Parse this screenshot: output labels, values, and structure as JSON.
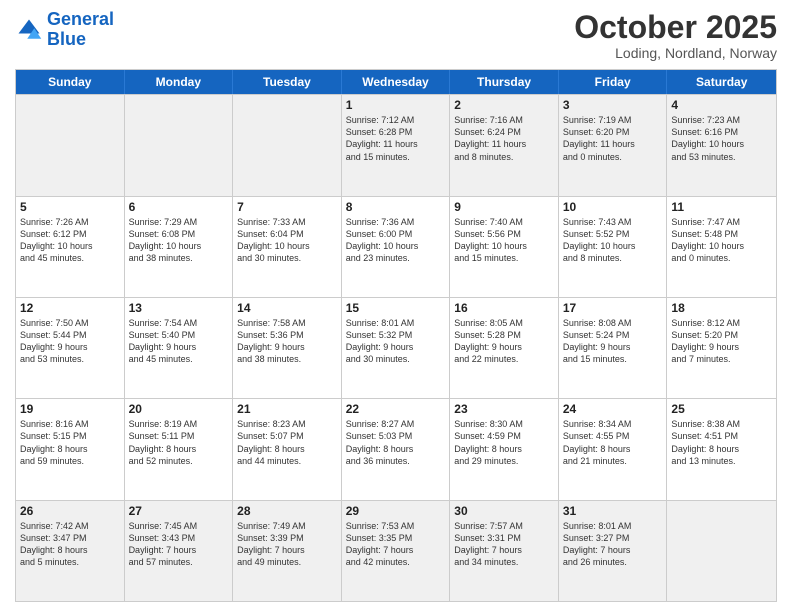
{
  "header": {
    "logo_general": "General",
    "logo_blue": "Blue",
    "month": "October 2025",
    "location": "Loding, Nordland, Norway"
  },
  "days_of_week": [
    "Sunday",
    "Monday",
    "Tuesday",
    "Wednesday",
    "Thursday",
    "Friday",
    "Saturday"
  ],
  "weeks": [
    [
      {
        "day": "",
        "info": [],
        "empty": true
      },
      {
        "day": "",
        "info": [],
        "empty": true
      },
      {
        "day": "",
        "info": [],
        "empty": true
      },
      {
        "day": "1",
        "info": [
          "Sunrise: 7:12 AM",
          "Sunset: 6:28 PM",
          "Daylight: 11 hours",
          "and 15 minutes."
        ],
        "empty": false
      },
      {
        "day": "2",
        "info": [
          "Sunrise: 7:16 AM",
          "Sunset: 6:24 PM",
          "Daylight: 11 hours",
          "and 8 minutes."
        ],
        "empty": false
      },
      {
        "day": "3",
        "info": [
          "Sunrise: 7:19 AM",
          "Sunset: 6:20 PM",
          "Daylight: 11 hours",
          "and 0 minutes."
        ],
        "empty": false
      },
      {
        "day": "4",
        "info": [
          "Sunrise: 7:23 AM",
          "Sunset: 6:16 PM",
          "Daylight: 10 hours",
          "and 53 minutes."
        ],
        "empty": false
      }
    ],
    [
      {
        "day": "5",
        "info": [
          "Sunrise: 7:26 AM",
          "Sunset: 6:12 PM",
          "Daylight: 10 hours",
          "and 45 minutes."
        ],
        "empty": false
      },
      {
        "day": "6",
        "info": [
          "Sunrise: 7:29 AM",
          "Sunset: 6:08 PM",
          "Daylight: 10 hours",
          "and 38 minutes."
        ],
        "empty": false
      },
      {
        "day": "7",
        "info": [
          "Sunrise: 7:33 AM",
          "Sunset: 6:04 PM",
          "Daylight: 10 hours",
          "and 30 minutes."
        ],
        "empty": false
      },
      {
        "day": "8",
        "info": [
          "Sunrise: 7:36 AM",
          "Sunset: 6:00 PM",
          "Daylight: 10 hours",
          "and 23 minutes."
        ],
        "empty": false
      },
      {
        "day": "9",
        "info": [
          "Sunrise: 7:40 AM",
          "Sunset: 5:56 PM",
          "Daylight: 10 hours",
          "and 15 minutes."
        ],
        "empty": false
      },
      {
        "day": "10",
        "info": [
          "Sunrise: 7:43 AM",
          "Sunset: 5:52 PM",
          "Daylight: 10 hours",
          "and 8 minutes."
        ],
        "empty": false
      },
      {
        "day": "11",
        "info": [
          "Sunrise: 7:47 AM",
          "Sunset: 5:48 PM",
          "Daylight: 10 hours",
          "and 0 minutes."
        ],
        "empty": false
      }
    ],
    [
      {
        "day": "12",
        "info": [
          "Sunrise: 7:50 AM",
          "Sunset: 5:44 PM",
          "Daylight: 9 hours",
          "and 53 minutes."
        ],
        "empty": false
      },
      {
        "day": "13",
        "info": [
          "Sunrise: 7:54 AM",
          "Sunset: 5:40 PM",
          "Daylight: 9 hours",
          "and 45 minutes."
        ],
        "empty": false
      },
      {
        "day": "14",
        "info": [
          "Sunrise: 7:58 AM",
          "Sunset: 5:36 PM",
          "Daylight: 9 hours",
          "and 38 minutes."
        ],
        "empty": false
      },
      {
        "day": "15",
        "info": [
          "Sunrise: 8:01 AM",
          "Sunset: 5:32 PM",
          "Daylight: 9 hours",
          "and 30 minutes."
        ],
        "empty": false
      },
      {
        "day": "16",
        "info": [
          "Sunrise: 8:05 AM",
          "Sunset: 5:28 PM",
          "Daylight: 9 hours",
          "and 22 minutes."
        ],
        "empty": false
      },
      {
        "day": "17",
        "info": [
          "Sunrise: 8:08 AM",
          "Sunset: 5:24 PM",
          "Daylight: 9 hours",
          "and 15 minutes."
        ],
        "empty": false
      },
      {
        "day": "18",
        "info": [
          "Sunrise: 8:12 AM",
          "Sunset: 5:20 PM",
          "Daylight: 9 hours",
          "and 7 minutes."
        ],
        "empty": false
      }
    ],
    [
      {
        "day": "19",
        "info": [
          "Sunrise: 8:16 AM",
          "Sunset: 5:15 PM",
          "Daylight: 8 hours",
          "and 59 minutes."
        ],
        "empty": false
      },
      {
        "day": "20",
        "info": [
          "Sunrise: 8:19 AM",
          "Sunset: 5:11 PM",
          "Daylight: 8 hours",
          "and 52 minutes."
        ],
        "empty": false
      },
      {
        "day": "21",
        "info": [
          "Sunrise: 8:23 AM",
          "Sunset: 5:07 PM",
          "Daylight: 8 hours",
          "and 44 minutes."
        ],
        "empty": false
      },
      {
        "day": "22",
        "info": [
          "Sunrise: 8:27 AM",
          "Sunset: 5:03 PM",
          "Daylight: 8 hours",
          "and 36 minutes."
        ],
        "empty": false
      },
      {
        "day": "23",
        "info": [
          "Sunrise: 8:30 AM",
          "Sunset: 4:59 PM",
          "Daylight: 8 hours",
          "and 29 minutes."
        ],
        "empty": false
      },
      {
        "day": "24",
        "info": [
          "Sunrise: 8:34 AM",
          "Sunset: 4:55 PM",
          "Daylight: 8 hours",
          "and 21 minutes."
        ],
        "empty": false
      },
      {
        "day": "25",
        "info": [
          "Sunrise: 8:38 AM",
          "Sunset: 4:51 PM",
          "Daylight: 8 hours",
          "and 13 minutes."
        ],
        "empty": false
      }
    ],
    [
      {
        "day": "26",
        "info": [
          "Sunrise: 7:42 AM",
          "Sunset: 3:47 PM",
          "Daylight: 8 hours",
          "and 5 minutes."
        ],
        "empty": false
      },
      {
        "day": "27",
        "info": [
          "Sunrise: 7:45 AM",
          "Sunset: 3:43 PM",
          "Daylight: 7 hours",
          "and 57 minutes."
        ],
        "empty": false
      },
      {
        "day": "28",
        "info": [
          "Sunrise: 7:49 AM",
          "Sunset: 3:39 PM",
          "Daylight: 7 hours",
          "and 49 minutes."
        ],
        "empty": false
      },
      {
        "day": "29",
        "info": [
          "Sunrise: 7:53 AM",
          "Sunset: 3:35 PM",
          "Daylight: 7 hours",
          "and 42 minutes."
        ],
        "empty": false
      },
      {
        "day": "30",
        "info": [
          "Sunrise: 7:57 AM",
          "Sunset: 3:31 PM",
          "Daylight: 7 hours",
          "and 34 minutes."
        ],
        "empty": false
      },
      {
        "day": "31",
        "info": [
          "Sunrise: 8:01 AM",
          "Sunset: 3:27 PM",
          "Daylight: 7 hours",
          "and 26 minutes."
        ],
        "empty": false
      },
      {
        "day": "",
        "info": [],
        "empty": true
      }
    ]
  ]
}
